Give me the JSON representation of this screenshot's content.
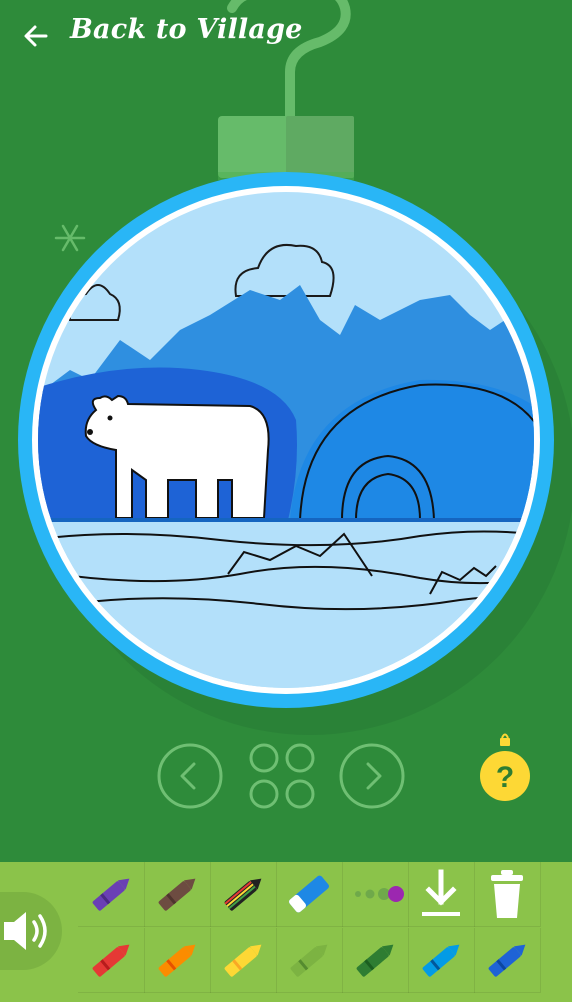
{
  "header": {
    "back_label": "Back to Village"
  },
  "icons": {
    "back": "arrow-left-icon",
    "prev": "chevron-left-icon",
    "next": "chevron-right-icon",
    "gallery": "four-circles-grid-icon",
    "help": "question-ornament-icon",
    "sound": "speaker-icon",
    "download": "download-icon",
    "trash": "trash-icon",
    "snowflake": "snowflake-icon"
  },
  "help": {
    "label": "?"
  },
  "colors": {
    "background": "#2e8b3a",
    "toolbar": "#8bc34a",
    "ornament_ring": "#29b6f6",
    "help_button": "#fdd835"
  },
  "palette": [
    {
      "name": "purple",
      "color": "#6a3fb5"
    },
    {
      "name": "brown",
      "color": "#6d4c41"
    },
    {
      "name": "rainbow",
      "color": "#222222"
    },
    {
      "name": "eraser",
      "color": "#1e88e5"
    },
    {
      "name": "brush-size",
      "color": "#9c27b0"
    },
    {
      "name": "red",
      "color": "#e53935"
    },
    {
      "name": "orange",
      "color": "#fb8c00"
    },
    {
      "name": "yellow",
      "color": "#fdd835"
    },
    {
      "name": "light-green",
      "color": "#7cb342"
    },
    {
      "name": "green",
      "color": "#2e7d32"
    },
    {
      "name": "light-blue",
      "color": "#039be5"
    },
    {
      "name": "blue",
      "color": "#1e63d6"
    }
  ]
}
